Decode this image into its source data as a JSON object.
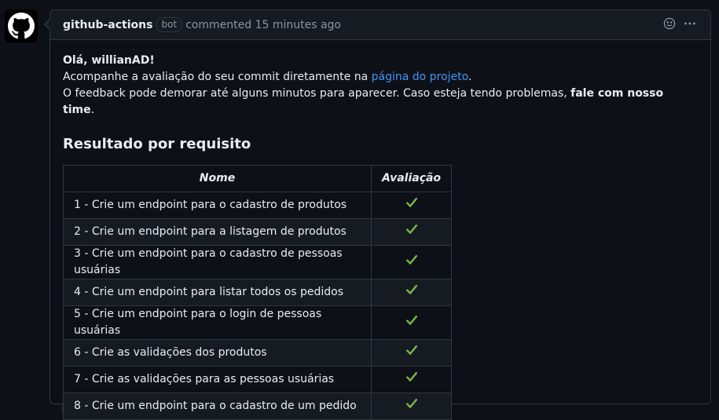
{
  "comment": {
    "author": "github-actions",
    "badge": "bot",
    "meta": "commented 15 minutes ago"
  },
  "body": {
    "greeting": "Olá, willianAD!",
    "line2_pre": "Acompanhe a avaliação do seu commit diretamente na ",
    "line2_link": "página do projeto",
    "line2_post": ".",
    "line3_pre": "O feedback pode demorar até alguns minutos para aparecer. Caso esteja tendo problemas, ",
    "line3_bold": "fale com nosso time",
    "line3_post": ".",
    "section_title": "Resultado por requisito"
  },
  "table": {
    "headers": [
      "Nome",
      "Avaliação"
    ],
    "rows": [
      {
        "name": "1 - Crie um endpoint para o cadastro de produtos",
        "result": "✔"
      },
      {
        "name": "2 - Crie um endpoint para a listagem de produtos",
        "result": "✔"
      },
      {
        "name": "3 - Crie um endpoint para o cadastro de pessoas usuárias",
        "result": "✔"
      },
      {
        "name": "4 - Crie um endpoint para listar todos os pedidos",
        "result": "✔"
      },
      {
        "name": "5 - Crie um endpoint para o login de pessoas usuárias",
        "result": "✔"
      },
      {
        "name": "6 - Crie as validações dos produtos",
        "result": "✔"
      },
      {
        "name": "7 - Crie as validações para as pessoas usuárias",
        "result": "✔"
      },
      {
        "name": "8 - Crie um endpoint para o cadastro de um pedido",
        "result": "✔"
      }
    ]
  },
  "icons": {
    "avatar": "github-logo-icon",
    "reaction": "smiley-icon",
    "more": "kebab-menu-icon",
    "check": "check-mark-icon"
  },
  "colors": {
    "link": "#4493f8",
    "check": "#7ab648",
    "background": "#0d1117",
    "border": "#30363d"
  }
}
